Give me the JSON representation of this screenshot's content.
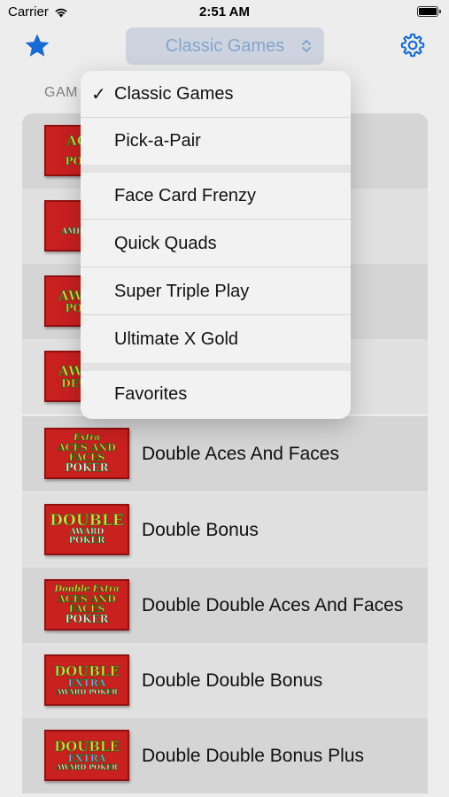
{
  "status_bar": {
    "carrier": "Carrier",
    "time": "2:51 AM"
  },
  "nav": {
    "picker_label": "Classic Games",
    "icons": {
      "left": "star-icon",
      "right": "gear-icon",
      "picker": "chevron-updown-icon"
    },
    "accent_color": "#1a73e8"
  },
  "section_header": "GAM",
  "menu": {
    "selected": "Classic Games",
    "items": [
      {
        "label": "Classic Games",
        "checked": true
      },
      {
        "label": "Pick-a-Pair"
      },
      {
        "label": "Face Card Frenzy"
      },
      {
        "label": "Quick Quads"
      },
      {
        "label": "Super Triple Play"
      },
      {
        "label": "Ultimate X Gold"
      },
      {
        "label": "Favorites"
      }
    ]
  },
  "games": [
    {
      "label": "",
      "logo": [
        "ACES",
        "&",
        "POKER"
      ]
    },
    {
      "label": "",
      "logo": [
        "A",
        "AMERICAN",
        ""
      ]
    },
    {
      "label": "",
      "logo": [
        "AWARD",
        "",
        "POKER"
      ]
    },
    {
      "label": "",
      "logo": [
        "AWARD",
        "",
        "DEUCES"
      ]
    },
    {
      "label": "Double Aces And Faces",
      "logo": [
        "Extra",
        "ACES AND FACES",
        "POKER"
      ]
    },
    {
      "label": "Double Bonus",
      "logo": [
        "DOUBLE",
        "AWARD",
        "POKER"
      ]
    },
    {
      "label": "Double Double Aces And Faces",
      "logo": [
        "Double Extra",
        "ACES AND FACES",
        "POKER"
      ]
    },
    {
      "label": "Double Double Bonus",
      "logo": [
        "DOUBLE",
        "EXTRA",
        "AWARD POKER"
      ]
    },
    {
      "label": "Double Double Bonus Plus",
      "logo": [
        "DOUBLE",
        "EXTRA",
        "AWARD POKER"
      ]
    }
  ]
}
